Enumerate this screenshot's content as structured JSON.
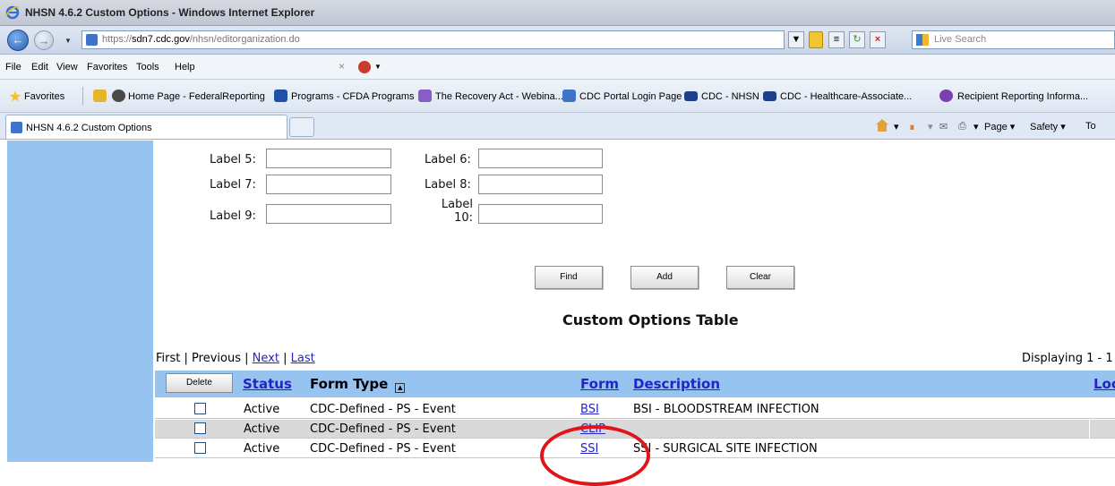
{
  "window": {
    "title": "NHSN 4.6.2 Custom Options - Windows Internet Explorer"
  },
  "address": {
    "scheme": "https://",
    "host": "sdn7.cdc.gov",
    "path": "/nhsn/editorganization.do",
    "search_placeholder": "Live Search"
  },
  "menu": [
    "File",
    "Edit",
    "View",
    "Favorites",
    "Tools",
    "Help"
  ],
  "favorites": {
    "label": "Favorites",
    "links": [
      "Home Page - FederalReporting",
      "Programs - CFDA Programs",
      "The Recovery Act - Webina...",
      "CDC Portal Login Page",
      "CDC - NHSN",
      "CDC - Healthcare-Associate...",
      "Recipient Reporting Informa..."
    ]
  },
  "tab": {
    "label": "NHSN 4.6.2 Custom Options"
  },
  "command_bar": {
    "page": "Page",
    "safety": "Safety",
    "tools": "To"
  },
  "labels": {
    "label5": "Label 5:",
    "label6": "Label 6:",
    "label7": "Label 7:",
    "label8": "Label 8:",
    "label9": "Label 9:",
    "label10_line1": "Label",
    "label10_line2": "10:"
  },
  "buttons": {
    "find": "Find",
    "add": "Add",
    "clear": "Clear",
    "delete": "Delete"
  },
  "table": {
    "title": "Custom Options Table",
    "pager": {
      "first": "First",
      "previous": "Previous",
      "next": "Next",
      "last": "Last",
      "sep": "|"
    },
    "displaying": "Displaying 1 - 1",
    "headers": {
      "status": "Status",
      "form_type": "Form Type",
      "form": "Form",
      "description": "Description",
      "location": "Loc"
    },
    "rows": [
      {
        "status": "Active",
        "form_type": "CDC-Defined - PS - Event",
        "form": "BSI",
        "description": "BSI - BLOODSTREAM INFECTION"
      },
      {
        "status": "Active",
        "form_type": "CDC-Defined - PS - Event",
        "form": "CLIP",
        "description": ""
      },
      {
        "status": "Active",
        "form_type": "CDC-Defined - PS - Event",
        "form": "SSI",
        "description": "SSI - SURGICAL SITE INFECTION"
      }
    ]
  },
  "colors": {
    "sidebar": "#96c3f0",
    "link": "#2323c8",
    "annotation_circle": "#e0141a"
  }
}
